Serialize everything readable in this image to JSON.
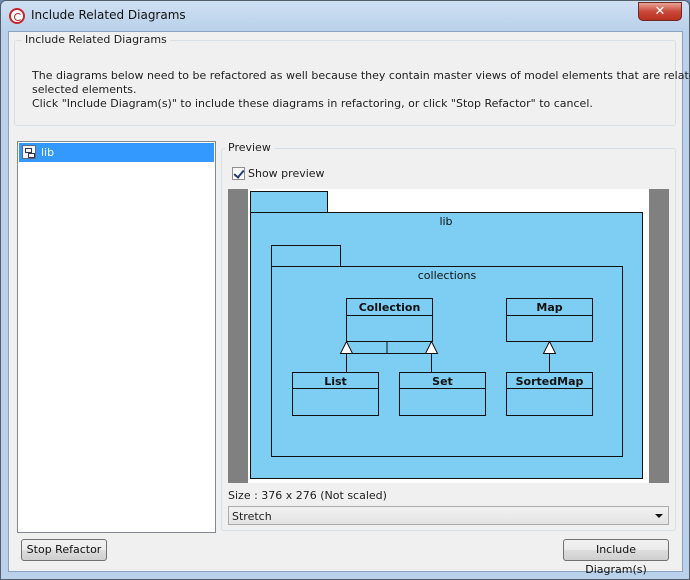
{
  "window": {
    "title": "Include Related Diagrams",
    "close_glyph": "✕"
  },
  "info_group": {
    "legend": "Include Related Diagrams",
    "lines": [
      "The diagrams below need to be refactored as well because they contain master views of model elements that are related the",
      "selected elements.",
      "Click \"Include Diagram(s)\" to include these diagrams in refactoring, or click \"Stop Refactor\" to cancel."
    ]
  },
  "diagram_list": {
    "items": [
      {
        "label": "lib",
        "icon": "class-diagram-icon",
        "selected": true
      }
    ]
  },
  "preview": {
    "legend": "Preview",
    "show_preview_label": "Show preview",
    "show_preview_checked": true,
    "size_text": "Size : 376 x 276 (Not scaled)",
    "scale_mode": "Stretch"
  },
  "diagram": {
    "package_name": "lib",
    "subpackage_name": "collections",
    "classes": {
      "collection": "Collection",
      "map": "Map",
      "list": "List",
      "set": "Set",
      "sortedmap": "SortedMap"
    }
  },
  "buttons": {
    "stop_refactor": "Stop Refactor",
    "include_diagrams": "Include Diagram(s)"
  },
  "colors": {
    "package_fill": "#7ecef4",
    "selection": "#3399ff",
    "preview_background": "#808080"
  }
}
